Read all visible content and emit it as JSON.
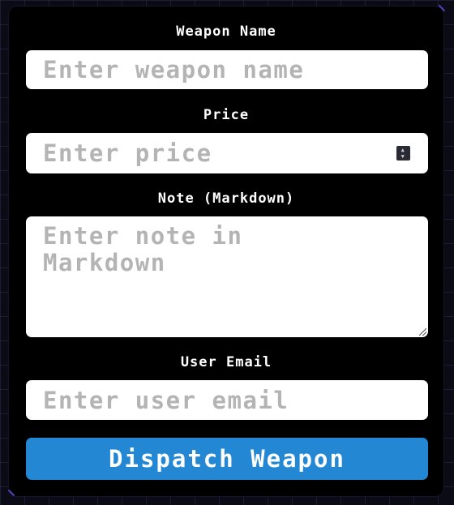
{
  "form": {
    "weapon_name": {
      "label": "Weapon Name",
      "placeholder": "Enter weapon name"
    },
    "price": {
      "label": "Price",
      "placeholder": "Enter price"
    },
    "note": {
      "label": "Note (Markdown)",
      "placeholder": "Enter note in Markdown"
    },
    "user_email": {
      "label": "User Email",
      "placeholder": "Enter user email"
    },
    "submit_label": "Dispatch Weapon"
  },
  "colors": {
    "page_background": "#0b0b16",
    "panel_background": "#000000",
    "button": "#2387d3",
    "placeholder_text": "#b4b4b4"
  },
  "icons": [
    "spinner-icon",
    "resize-handle-icon"
  ]
}
